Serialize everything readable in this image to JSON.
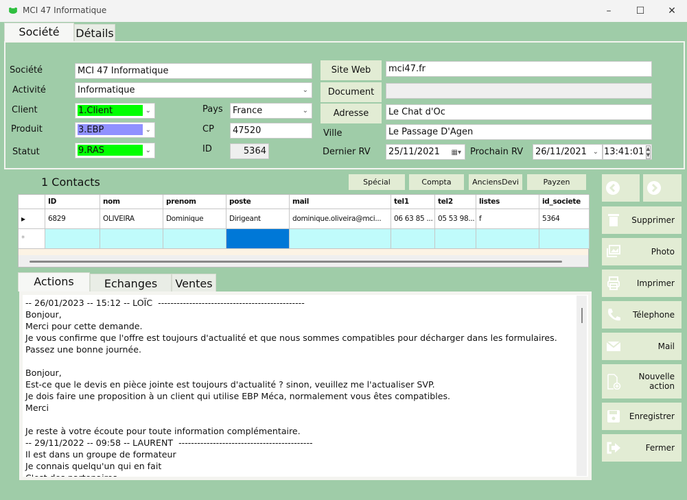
{
  "window": {
    "title": "MCI 47 Informatique",
    "icon": "frog-icon"
  },
  "tabs_top": [
    {
      "label": "Société",
      "selected": true
    },
    {
      "label": "Détails",
      "selected": false
    }
  ],
  "form": {
    "societe": {
      "label": "Société",
      "value": "MCI 47 Informatique"
    },
    "activite": {
      "label": "Activité",
      "value": "Informatique"
    },
    "client": {
      "label": "Client",
      "value": "1.Client",
      "color": "#00ff00"
    },
    "produit": {
      "label": "Produit",
      "value": "3.EBP",
      "color": "#9090ff"
    },
    "statut": {
      "label": "Statut",
      "value": "9.RAS",
      "color": "#00ff00"
    },
    "pays": {
      "label": "Pays",
      "value": "France"
    },
    "cp": {
      "label": "CP",
      "value": "47520"
    },
    "id": {
      "label": "ID",
      "value": "5364"
    },
    "site_web": {
      "label": "Site Web",
      "value": "mci47.fr"
    },
    "document": {
      "label": "Document",
      "value": ""
    },
    "adresse": {
      "label": "Adresse",
      "value": "Le Chat d'Oc"
    },
    "ville": {
      "label": "Ville",
      "value": "Le Passage D'Agen"
    },
    "dernier_rv": {
      "label": "Dernier RV",
      "value": "25/11/2021"
    },
    "prochain_rv": {
      "label": "Prochain RV",
      "date": "26/11/2021",
      "time": "13:41:01"
    }
  },
  "contacts": {
    "count_label": "1 Contacts",
    "buttons": [
      "Spécial",
      "Compta",
      "AnciensDevi",
      "Payzen"
    ],
    "columns": [
      "ID",
      "nom",
      "prenom",
      "poste",
      "mail",
      "tel1",
      "tel2",
      "listes",
      "id_societe"
    ],
    "rows": [
      [
        "6829",
        "OLIVEIRA",
        "Dominique",
        "Dirigeant",
        "dominique.oliveira@mci...",
        "06 63 85 ...",
        "05 53 98...",
        "f",
        "5364"
      ]
    ],
    "new_row_selected_color": "#0078d7"
  },
  "tabs_bottom": [
    {
      "label": "Actions",
      "selected": true
    },
    {
      "label": "Echanges",
      "selected": false
    },
    {
      "label": "Ventes",
      "selected": false
    }
  ],
  "actions_text": [
    "-- 26/01/2023 -- 15:12 -- LOÏC  -----------------------------------------------",
    "Bonjour,",
    "Merci pour cette demande.",
    "Je vous confirme que l'offre est toujours d'actualité et que nous sommes compatibles pour décharger dans les formulaires.",
    "Passez une bonne journée.",
    "",
    "Bonjour,",
    "Est-ce que le devis en pièce jointe est toujours d'actualité ? sinon, veuillez me l'actualiser SVP.",
    "Je dois faire une proposition à un client qui utilise EBP Méca, normalement vous êtes compatibles.",
    "Merci",
    "",
    "Je reste à votre écoute pour toute information complémentaire.",
    "-- 29/11/2022 -- 09:58 -- LAURENT  -------------------------------------------",
    "Il est dans un groupe de formateur",
    "Je connais quelqu'un qui en fait",
    "C'est des partenaires"
  ],
  "side_buttons": [
    {
      "label": "Supprimer",
      "icon": "trash-icon"
    },
    {
      "label": "Photo",
      "icon": "photo-icon"
    },
    {
      "label": "Imprimer",
      "icon": "printer-icon"
    },
    {
      "label": "Télephone",
      "icon": "phone-icon"
    },
    {
      "label": "Mail",
      "icon": "mail-icon"
    },
    {
      "label": "Nouvelle action",
      "icon": "new-document-icon"
    },
    {
      "label": "Enregistrer",
      "icon": "save-icon"
    },
    {
      "label": "Fermer",
      "icon": "exit-icon"
    }
  ],
  "nav": {
    "prev": "chevron-left-icon",
    "next": "chevron-right-icon"
  }
}
